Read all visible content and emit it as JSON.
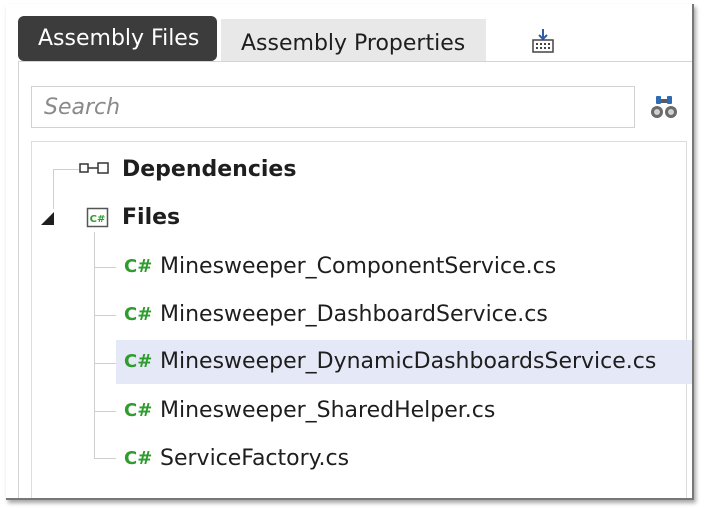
{
  "tabs": [
    {
      "label": "Assembly Files",
      "active": true
    },
    {
      "label": "Assembly Properties",
      "active": false
    }
  ],
  "toolbar": {
    "export_icon": "export-download-icon"
  },
  "search": {
    "placeholder": "Search",
    "value": "",
    "find_icon": "binoculars-icon"
  },
  "tree": {
    "dependencies": {
      "label": "Dependencies",
      "icon": "dependencies-icon"
    },
    "files": {
      "label": "Files",
      "icon": "csharp-folder-icon",
      "expanded": true,
      "items": [
        {
          "icon_text": "C#",
          "label": "Minesweeper_ComponentService.cs"
        },
        {
          "icon_text": "C#",
          "label": "Minesweeper_DashboardService.cs"
        },
        {
          "icon_text": "C#",
          "label": "Minesweeper_DynamicDashboardsService.cs",
          "selected": true
        },
        {
          "icon_text": "C#",
          "label": "Minesweeper_SharedHelper.cs"
        },
        {
          "icon_text": "C#",
          "label": "ServiceFactory.cs"
        }
      ]
    }
  },
  "colors": {
    "active_tab_bg": "#3c3c3c",
    "inactive_tab_bg": "#e8e8e8",
    "csharp_green": "#2e9d2e",
    "selection_bg": "#e5e8f7"
  }
}
